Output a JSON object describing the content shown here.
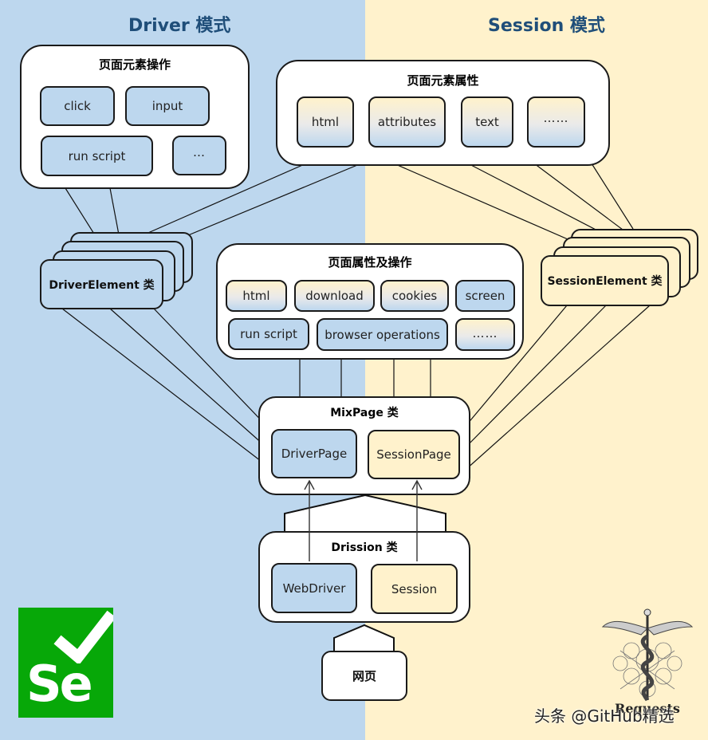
{
  "modes": {
    "driver_title": "Driver 模式",
    "session_title": "Session 模式"
  },
  "colors": {
    "driver_bg": "#bdd7ee",
    "session_bg": "#fff2cc",
    "title_color": "#1f4e79",
    "selenium_green": "#07a808"
  },
  "element_ops": {
    "title": "页面元素操作",
    "items": [
      "click",
      "input",
      "run script",
      "…"
    ]
  },
  "element_attrs": {
    "title": "页面元素属性",
    "items": [
      "html",
      "attributes",
      "text",
      "……"
    ]
  },
  "driver_element": {
    "label": "DriverElement 类"
  },
  "session_element": {
    "label": "SessionElement 类"
  },
  "page_ops": {
    "title": "页面属性及操作",
    "row1": [
      "html",
      "download",
      "cookies",
      "screen"
    ],
    "row2": [
      "run script",
      "browser operations",
      "……"
    ]
  },
  "mixpage": {
    "title": "MixPage 类",
    "driver_page": "DriverPage",
    "session_page": "SessionPage"
  },
  "drission": {
    "title": "Drission 类",
    "webdriver": "WebDriver",
    "session": "Session"
  },
  "webpage": {
    "label": "网页"
  },
  "logos": {
    "selenium": "Se",
    "selenium_icon": "checkmark-icon",
    "requests": "Requests",
    "requests_icon": "caduceus-icon"
  },
  "watermark": "头条 @GitHub精选"
}
